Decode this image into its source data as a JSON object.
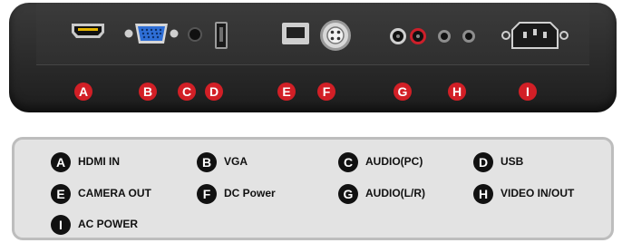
{
  "colors": {
    "panel": "#2c2c2c",
    "callout": "#d21f26",
    "legend_bg": "#e3e3e3",
    "legend_badge": "#111111"
  },
  "callouts": [
    "A",
    "B",
    "C",
    "D",
    "E",
    "F",
    "G",
    "H",
    "I"
  ],
  "legend": [
    {
      "letter": "A",
      "label": "HDMI IN"
    },
    {
      "letter": "B",
      "label": "VGA"
    },
    {
      "letter": "C",
      "label": "AUDIO(PC)"
    },
    {
      "letter": "D",
      "label": "USB"
    },
    {
      "letter": "E",
      "label": "CAMERA OUT"
    },
    {
      "letter": "F",
      "label": "DC Power"
    },
    {
      "letter": "G",
      "label": "AUDIO(L/R)"
    },
    {
      "letter": "H",
      "label": "VIDEO IN/OUT"
    },
    {
      "letter": "I",
      "label": "AC POWER"
    }
  ]
}
